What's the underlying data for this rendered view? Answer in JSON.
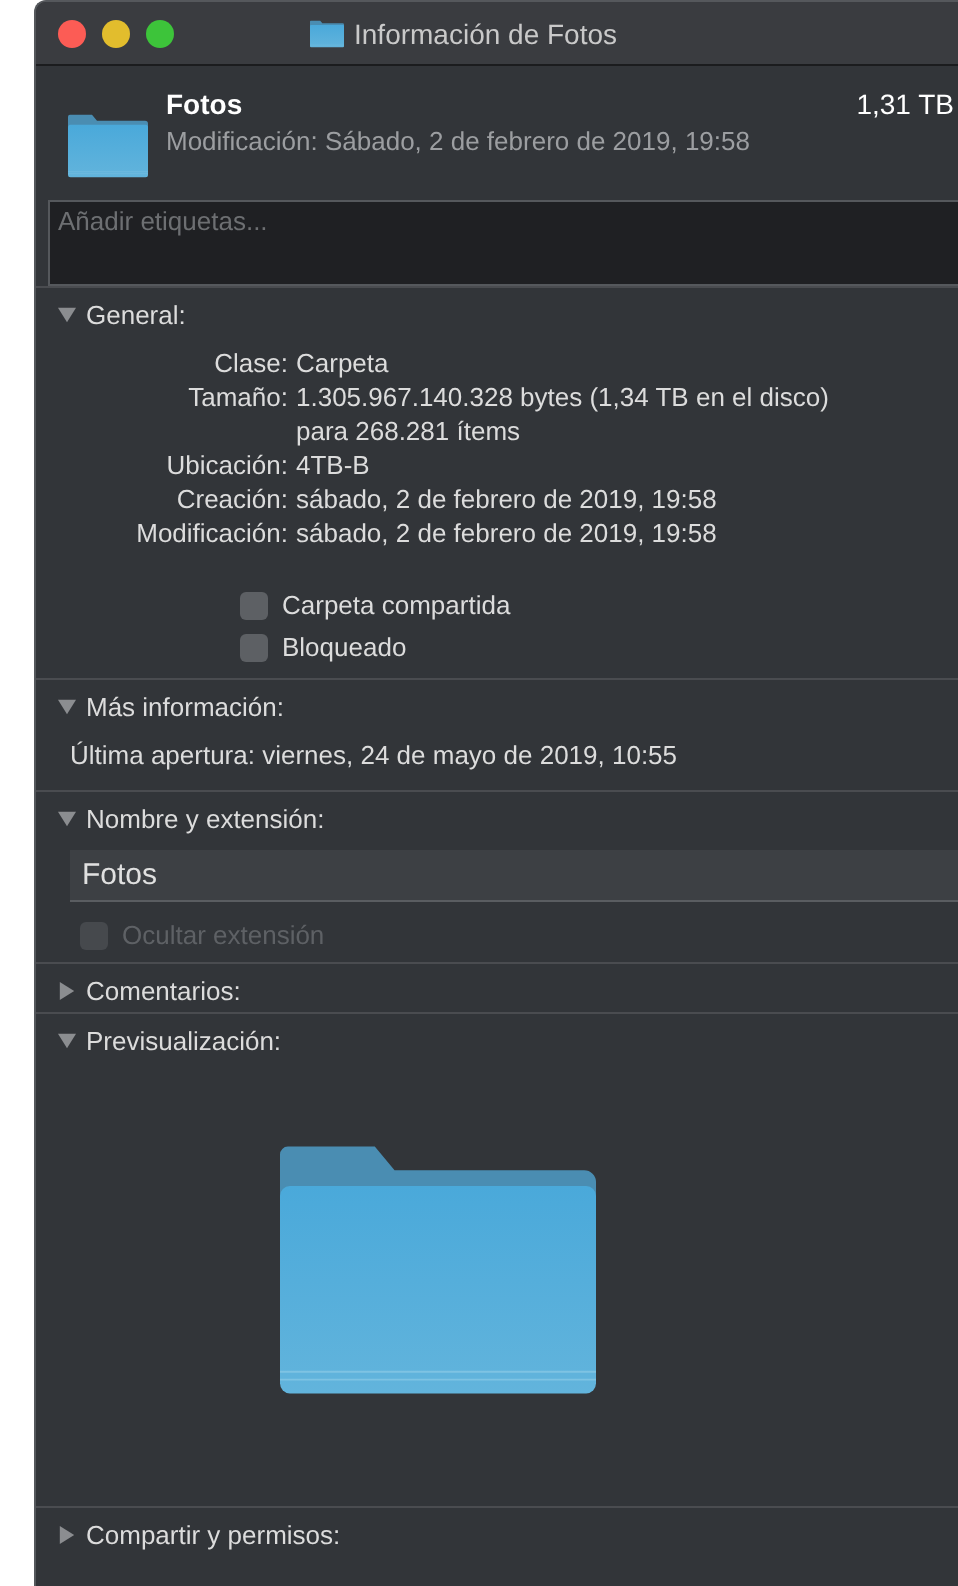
{
  "window": {
    "title": "Información de Fotos"
  },
  "header": {
    "name": "Fotos",
    "size": "1,31 TB",
    "modified": "Modificación: Sábado, 2 de febrero de 2019, 19:58"
  },
  "tags": {
    "placeholder": "Añadir etiquetas..."
  },
  "sections": [
    {
      "kind": "general",
      "title": "General:",
      "expanded": true,
      "rows": [
        {
          "label": "Clase:",
          "value": "Carpeta"
        },
        {
          "label": "Tamaño:",
          "value": "1.305.967.140.328 bytes (1,34 TB en el disco)",
          "extra": "para 268.281 ítems"
        },
        {
          "label": "Ubicación:",
          "value": "4TB-B"
        },
        {
          "label": "Creación:",
          "value": "sábado, 2 de febrero de 2019, 19:58"
        },
        {
          "label": "Modificación:",
          "value": "sábado, 2 de febrero de 2019, 19:58"
        }
      ],
      "checkboxes": [
        {
          "label": "Carpeta compartida",
          "checked": false,
          "disabled": false
        },
        {
          "label": "Bloqueado",
          "checked": false,
          "disabled": false
        }
      ]
    },
    {
      "kind": "text",
      "title": "Más información:",
      "expanded": true,
      "text": "Última apertura: viernes, 24 de mayo de 2019, 10:55"
    },
    {
      "kind": "name",
      "title": "Nombre y extensión:",
      "expanded": true,
      "value": "Fotos",
      "checkboxes": [
        {
          "label": "Ocultar extensión",
          "checked": false,
          "disabled": true
        }
      ]
    },
    {
      "title": "Comentarios:",
      "expanded": false
    },
    {
      "kind": "preview",
      "title": "Previsualización:",
      "expanded": true
    },
    {
      "title": "Compartir y permisos:",
      "expanded": false
    }
  ]
}
